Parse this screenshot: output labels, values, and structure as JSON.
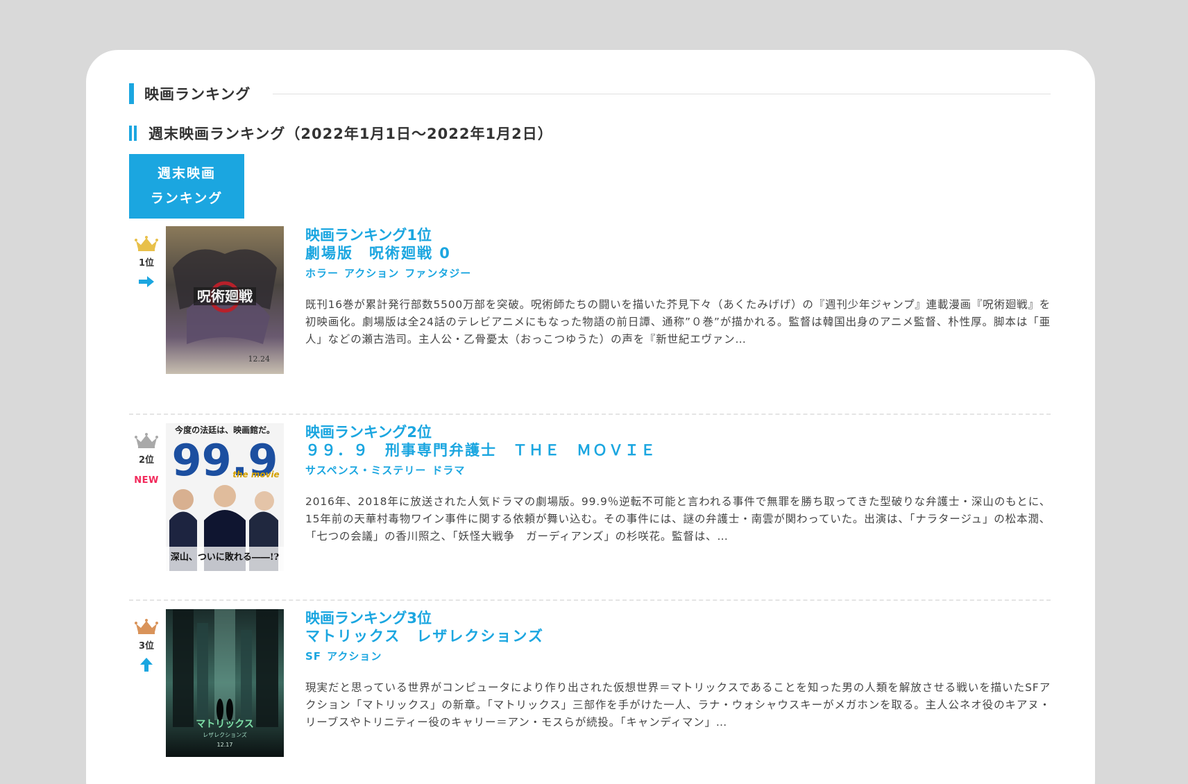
{
  "section": {
    "title": "映画ランキング"
  },
  "subsection": {
    "title": "週末映画ランキング（2022年1月1日～2022年1月2日）"
  },
  "tab": {
    "line1": "週末映画",
    "line2": "ランキング"
  },
  "colors": {
    "accent": "#1ba6e0",
    "new_badge": "#f2295b",
    "gold": "#e8c04a",
    "silver": "#a9a9a9",
    "bronze": "#d9935a"
  },
  "items": [
    {
      "rank_text": "1位",
      "rank_label": "映画ランキング1位",
      "title": "劇場版　呪術廻戦 0",
      "genres": [
        "ホラー",
        "アクション",
        "ファンタジー"
      ],
      "trend": "right-arrow-icon",
      "description": "既刊16巻が累計発行部数5500万部を突破。呪術師たちの闘いを描いた芥見下々（あくたみげげ）の『週刊少年ジャンプ』連載漫画『呪術廻戦』を初映画化。劇場版は全24話のテレビアニメにもなった物語の前日譚、通称”０巻”が描かれる。監督は韓国出身のアニメ監督、朴性厚。脚本は「亜人」などの瀬古浩司。主人公・乙骨憂太（おっこつゆうた）の声を『新世紀エヴァン…",
      "poster_text": "12.24"
    },
    {
      "rank_text": "2位",
      "rank_label": "映画ランキング2位",
      "title": "９９．９　刑事専門弁護士　ＴＨＥ　ＭＯＶＩＥ",
      "genres": [
        "サスペンス・ミステリー",
        "ドラマ"
      ],
      "badge": "NEW",
      "description": "2016年、2018年に放送された人気ドラマの劇場版。99.9％逆転不可能と言われる事件で無罪を勝ち取ってきた型破りな弁護士・深山のもとに、15年前の天華村毒物ワイン事件に関する依頼が舞い込む。その事件には、謎の弁護士・南雲が関わっていた。出演は、「ナラタージュ」の松本潤、「七つの会議」の香川照之、「妖怪大戦争　ガーディアンズ」の杉咲花。監督は、…",
      "poster_top": "今度の法廷は、映画館だ。",
      "poster_big": "99.9",
      "poster_sub": "the movie",
      "poster_bottom": "深山、ついに敗れる――!?"
    },
    {
      "rank_text": "3位",
      "rank_label": "映画ランキング3位",
      "title": "マトリックス　レザレクションズ",
      "genres": [
        "SF",
        "アクション"
      ],
      "trend": "up-arrow-icon",
      "description": "現実だと思っている世界がコンピュータにより作り出された仮想世界＝マトリックスであることを知った男の人類を解放させる戦いを描いたSFアクション「マトリックス」の新章。「マトリックス」三部作を手がけた一人、ラナ・ウォシャウスキーがメガホンを取る。主人公ネオ役のキアヌ・リーブスやトリニティー役のキャリー＝アン・モスらが続投。「キャンディマン」…",
      "poster_title": "マトリックス",
      "poster_subtitle": "レザレクションズ",
      "poster_date": "12.17"
    }
  ]
}
